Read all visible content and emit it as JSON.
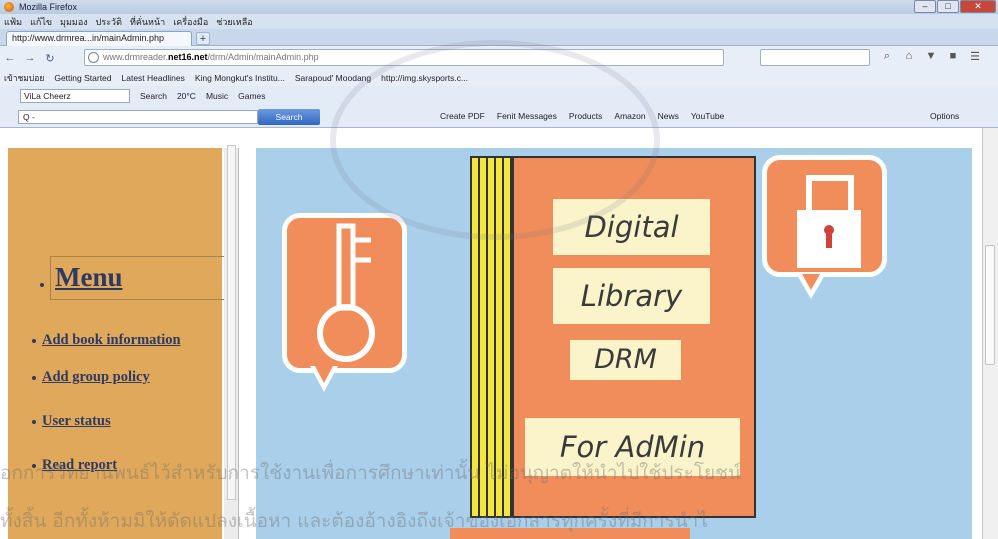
{
  "window": {
    "title": "Mozilla Firefox",
    "controls": [
      "–",
      "□",
      "✕"
    ]
  },
  "menubar": {
    "items": [
      "แฟ้ม",
      "แก้ไข",
      "มุมมอง",
      "ประวัติ",
      "ที่คั่นหน้า",
      "เครื่องมือ",
      "ช่วยเหลือ"
    ]
  },
  "tab": {
    "label": "http://www.drmrea...in/mainAdmin.php",
    "new_tab": "+"
  },
  "navigation": {
    "url_prefix": "www.drmreader.",
    "url_domain": "net16.net",
    "url_suffix": "/drm/Admin/mainAdmin.php",
    "back": "←",
    "forward": "→",
    "reload": "↻",
    "right_icons": [
      "⌕",
      "⌂",
      "▼",
      "■",
      "☰"
    ]
  },
  "bookmarks": [
    "เข้าชมบ่อย",
    "Getting Started",
    "Latest Headlines",
    "King Mongkut's Institu...",
    "Sarapoud' Moodang",
    "http://img.skysports.c..."
  ],
  "toolbar1": {
    "profile": "ViLa Cheerz",
    "items": [
      "Search",
      "20°C",
      "Music",
      "Games"
    ]
  },
  "toolbar2": {
    "input_value": "Q -",
    "search_button": "Search",
    "links": [
      "Create PDF",
      "Fenit Messages",
      "Products",
      "Amazon",
      "News",
      "YouTube"
    ],
    "options": "Options"
  },
  "sidebar": {
    "title": "Menu",
    "items": [
      {
        "label": "Add book information"
      },
      {
        "label": "Add group policy"
      },
      {
        "label": "User status"
      },
      {
        "label": "Read report"
      }
    ]
  },
  "banner": {
    "line1": "Digital",
    "line2": "Library",
    "line3": "DRM",
    "line4": "For AdMin"
  },
  "watermark": {
    "line1": "อกการวิทยานิพนธ์ไว้สำหรับการใช้งานเพื่อการศึกษาเท่านั้น ไม่อนุญาตให้นำไปใช้ประโยชน์",
    "line2": "ทั้งสิ้น อีกทั้งห้ามมิให้ดัดแปลงเนื้อหา และต้องอ้างอิงถึงเจ้าของเอกสารทุกครั้งที่มีการนำไ"
  },
  "colors": {
    "sidebar_bg": "#e0a85a",
    "main_bg": "#a9cfeb",
    "accent_orange": "#f08d5a",
    "label_bg": "#fbf3c9",
    "link_color": "#2d3a63"
  }
}
